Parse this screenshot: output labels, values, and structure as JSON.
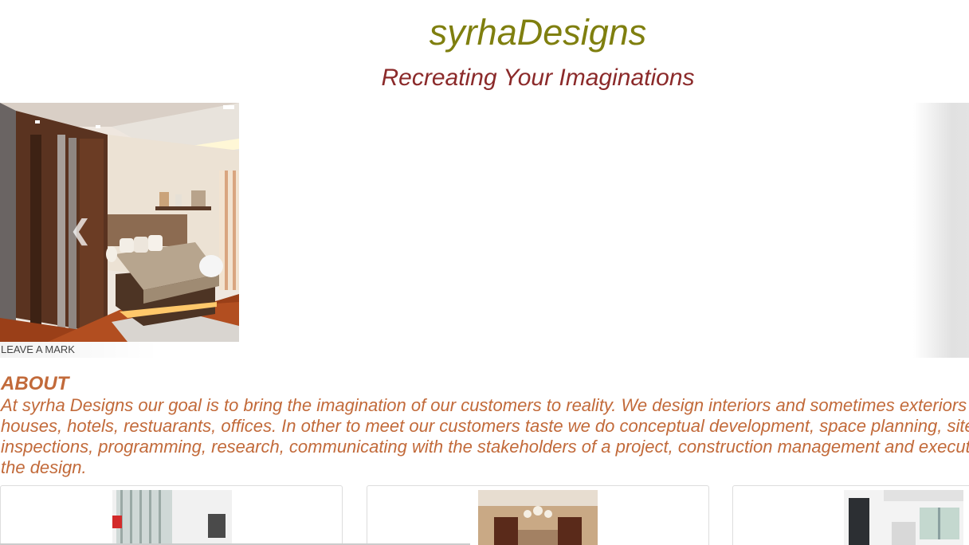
{
  "header": {
    "site_title": "syrhaDesigns",
    "tagline": "Recreating Your Imaginations"
  },
  "carousel": {
    "caption": "LEAVE A MARK",
    "prev_icon": "chevron-left-icon"
  },
  "about": {
    "heading": "ABOUT",
    "text": "At syrha Designs our goal is to bring the imagination of our customers to reality. We design interiors and sometimes exteriors of houses, hotels, restuarants, offices. In other to meet our customers taste we do conceptual development, space planning, site inspections, programming, research, communicating with the stakeholders of a project, construction management and execution of the design."
  },
  "colors": {
    "title": "#7f7f0f",
    "tagline": "#8b2a2a",
    "about": "#c26a3a"
  }
}
